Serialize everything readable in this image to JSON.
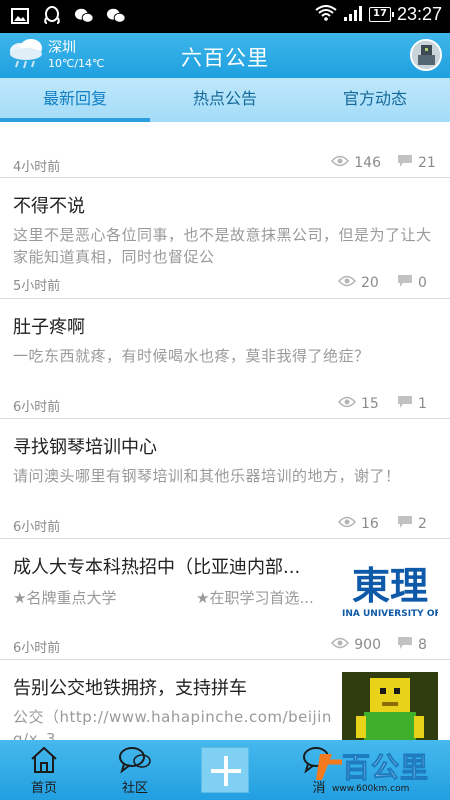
{
  "status_bar": {
    "time": "23:27",
    "battery": "17",
    "icons": [
      "gallery-icon",
      "qq-icon",
      "wechat-icon",
      "wechat-icon",
      "wifi-icon",
      "signal-icon",
      "battery-icon"
    ]
  },
  "header": {
    "city": "深圳",
    "temperature": "10℃/14℃",
    "title": "六百公里",
    "weather_icon": "cloud-rain-icon",
    "accent": "#1ea0e0"
  },
  "tabs": [
    {
      "label": "最新回复",
      "active": true
    },
    {
      "label": "热点公告",
      "active": false
    },
    {
      "label": "官方动态",
      "active": false
    }
  ],
  "posts": [
    {
      "title": "",
      "summary": "",
      "time": "4小时前",
      "views": "146",
      "replies": "21"
    },
    {
      "title": "不得不说",
      "summary": "这里不是恶心各位同事，也不是故意抹黑公司，但是为了让大家能知道真相，同时也督促公",
      "time": "5小时前",
      "views": "20",
      "replies": "0"
    },
    {
      "title": "肚子疼啊",
      "summary": "一吃东西就疼，有时候喝水也疼，莫非我得了绝症？",
      "time": "6小时前",
      "views": "15",
      "replies": "1"
    },
    {
      "title": "寻找钢琴培训中心",
      "summary": "请问澳头哪里有钢琴培训和其他乐器培训的地方，谢了！",
      "time": "6小时前",
      "views": "16",
      "replies": "2"
    },
    {
      "title": "成人大专本科热招中（比亚迪内部...",
      "tag1": "★名牌重点大学",
      "tag2": "★在职学习首选...",
      "time": "6小时前",
      "views": "900",
      "replies": "8",
      "thumb_text": "東理",
      "thumb_caption": "INA UNIVERSITY OF S"
    },
    {
      "title": "告别公交地铁拥挤，支持拼车",
      "summary": "公交（http://www.hahapinche.com/beijing/x_3...",
      "time": "",
      "views": "",
      "replies": ""
    }
  ],
  "bottom_nav": [
    {
      "label": "首页",
      "icon": "home-icon"
    },
    {
      "label": "社区",
      "icon": "chat-bubbles-icon"
    },
    {
      "label": "",
      "icon": "plus-icon"
    },
    {
      "label": "消",
      "icon": "chat-bubbles-icon"
    }
  ],
  "watermark": {
    "text": "百公里",
    "url": "www.600km.com"
  }
}
